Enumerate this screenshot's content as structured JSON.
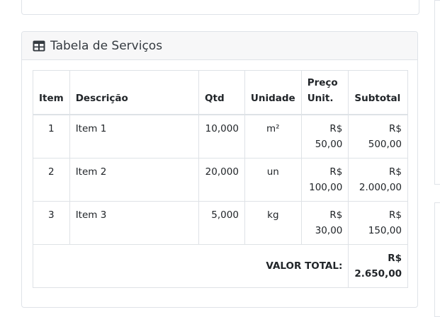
{
  "card": {
    "title": "Tabela de Serviços",
    "icon": "table-icon"
  },
  "table": {
    "headers": {
      "item": "Item",
      "descricao": "Descrição",
      "qtd": "Qtd",
      "unidade": "Unidade",
      "preco": "Preço Unit.",
      "subtotal": "Subtotal"
    },
    "rows": [
      {
        "item": "1",
        "descricao": "Item 1",
        "qtd": "10,000",
        "unidade": "m²",
        "preco": "R$ 50,00",
        "subtotal": "R$ 500,00"
      },
      {
        "item": "2",
        "descricao": "Item 2",
        "qtd": "20,000",
        "unidade": "un",
        "preco": "R$ 100,00",
        "subtotal": "R$ 2.000,00"
      },
      {
        "item": "3",
        "descricao": "Item 3",
        "qtd": "5,000",
        "unidade": "kg",
        "preco": "R$ 30,00",
        "subtotal": "R$ 150,00"
      }
    ],
    "total_label": "VALOR TOTAL:",
    "total_value": "R$ 2.650,00"
  }
}
